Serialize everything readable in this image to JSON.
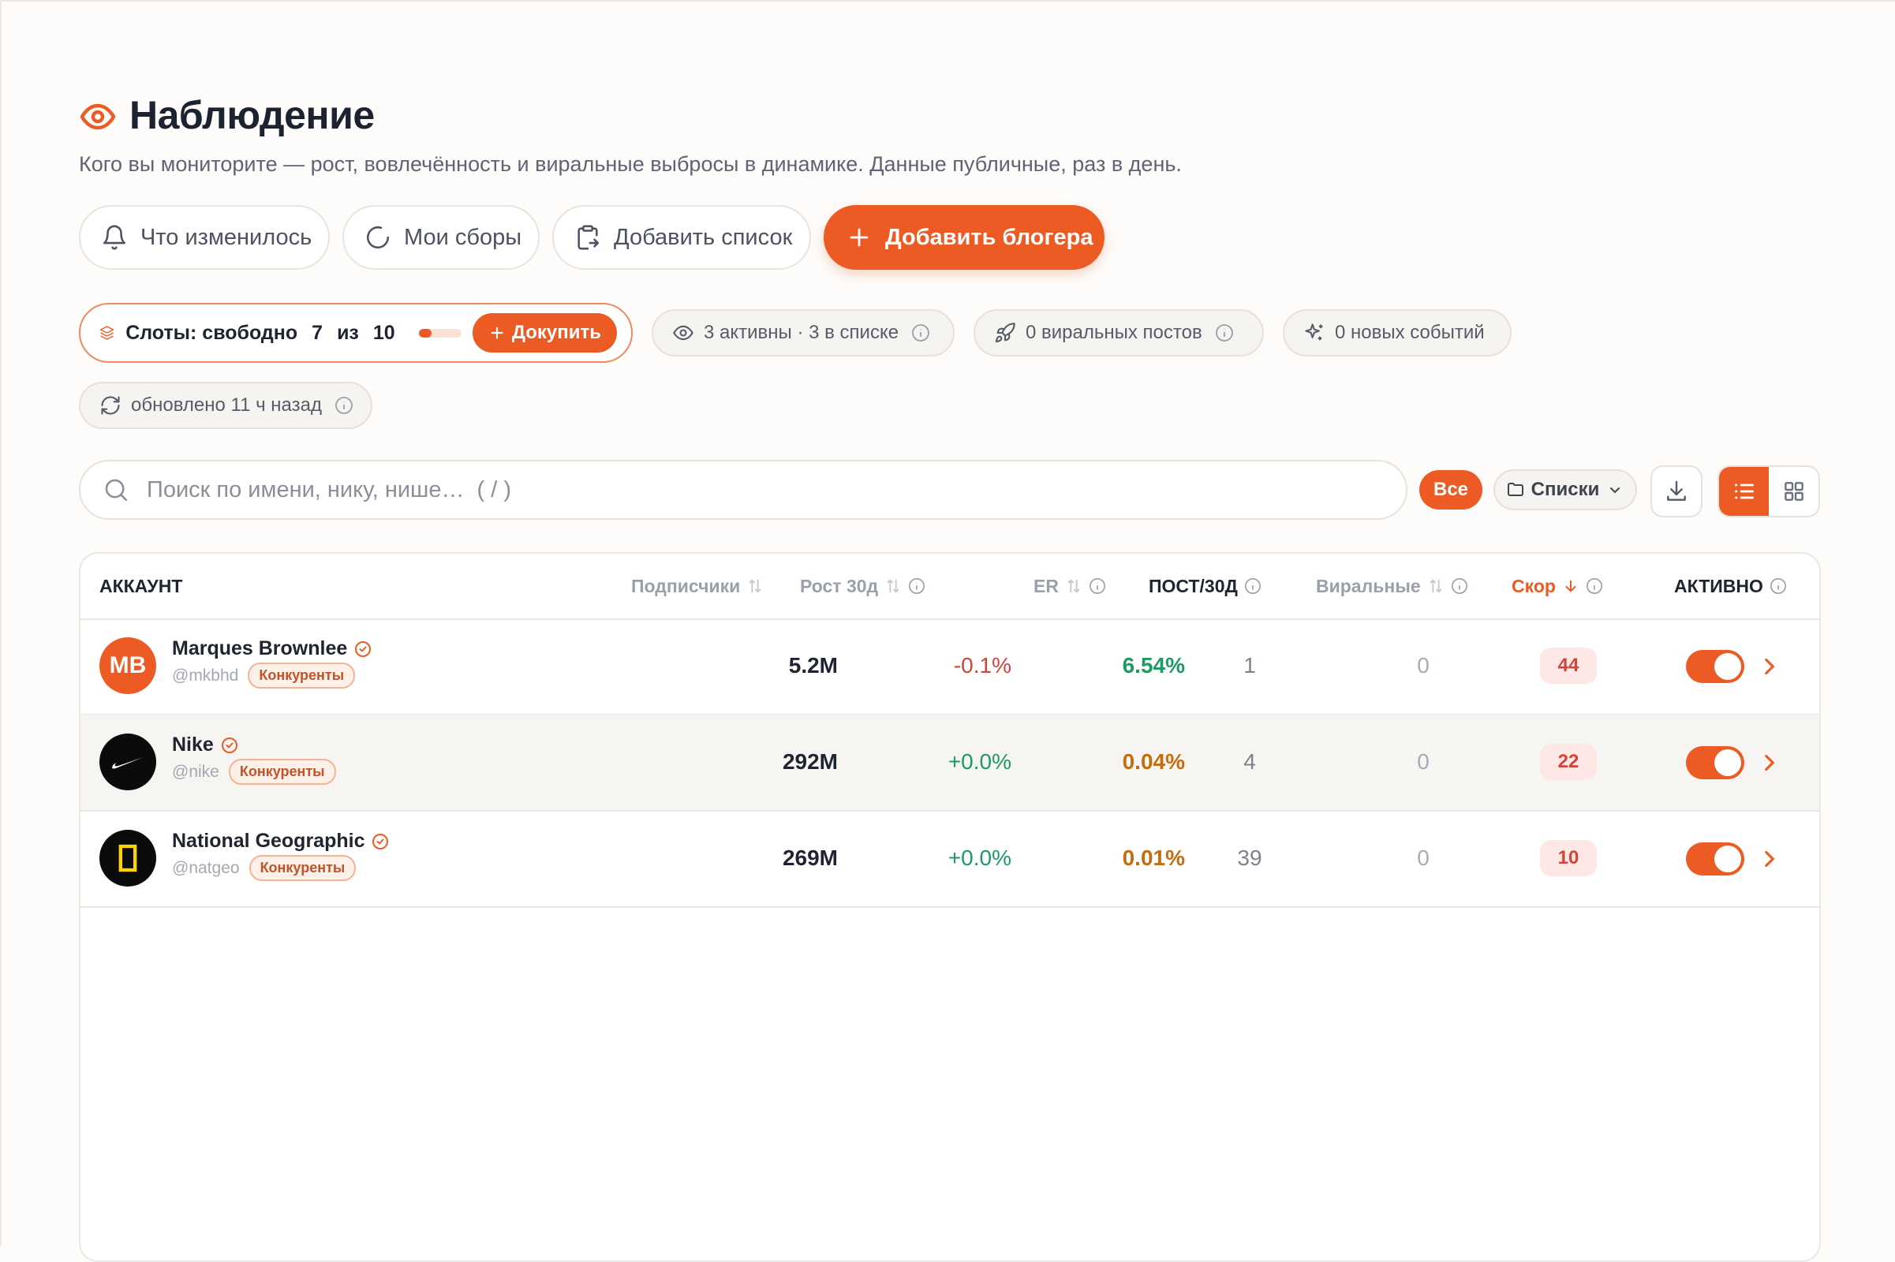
{
  "header": {
    "title": "Наблюдение",
    "subtitle": "Кого вы мониторите — рост, вовлечённость и виральные выбросы в динамике. Данные публичные, раз в день."
  },
  "actions": {
    "changes": "Что изменилось",
    "collections": "Мои сборы",
    "add_list": "Добавить список",
    "add_blogger": "Добавить блогера"
  },
  "slots": {
    "prefix": "Слоты: свободно",
    "free": "7",
    "of_word": "из",
    "total": "10",
    "used_fraction": 0.3,
    "buy_label": "Докупить"
  },
  "status": {
    "active": "3 активны · 3 в списке",
    "viral": "0 виральных постов",
    "events": "0 новых событий",
    "updated": "обновлено 11 ч назад"
  },
  "search": {
    "placeholder": "Поиск по имени, нику, нише…  ( / )"
  },
  "filters": {
    "all": "Все",
    "lists": "Списки"
  },
  "table": {
    "columns": {
      "account": "АККАУНТ",
      "followers": "Подписчики",
      "growth": "Рост 30д",
      "er": "ER",
      "posts": "ПОСТ/30Д",
      "viral": "Виральные",
      "score": "Скор",
      "active": "АКТИВНО"
    },
    "rows": [
      {
        "name": "Marques Brownlee",
        "avatar_text": "MB",
        "handle": "@mkbhd",
        "tag": "Конкуренты",
        "followers": "5.2M",
        "growth": "-0.1%",
        "er": "6.54%",
        "posts": "1",
        "viral": "0",
        "score": "44",
        "active": true
      },
      {
        "name": "Nike",
        "handle": "@nike",
        "tag": "Конкуренты",
        "followers": "292M",
        "growth": "+0.0%",
        "er": "0.04%",
        "posts": "4",
        "viral": "0",
        "score": "22",
        "active": true
      },
      {
        "name": "National Geographic",
        "handle": "@natgeo",
        "tag": "Конкуренты",
        "followers": "269M",
        "growth": "+0.0%",
        "er": "0.01%",
        "posts": "39",
        "viral": "0",
        "score": "10",
        "active": true
      }
    ]
  },
  "colors": {
    "accent": "#ec5b24",
    "positive": "#1e9a63",
    "negative": "#d0453b",
    "er_low": "#c46d10"
  },
  "icons": [
    "eye-icon",
    "bell-icon",
    "loader-icon",
    "clipboard-icon",
    "plus-icon",
    "layers-icon",
    "rocket-icon",
    "sparkles-icon",
    "refresh-icon",
    "info-icon",
    "search-icon",
    "folder-icon",
    "chevron-down-icon",
    "download-icon",
    "list-view-icon",
    "grid-view-icon",
    "sort-icon",
    "arrow-down-icon",
    "verified-icon",
    "chevron-right-icon"
  ]
}
